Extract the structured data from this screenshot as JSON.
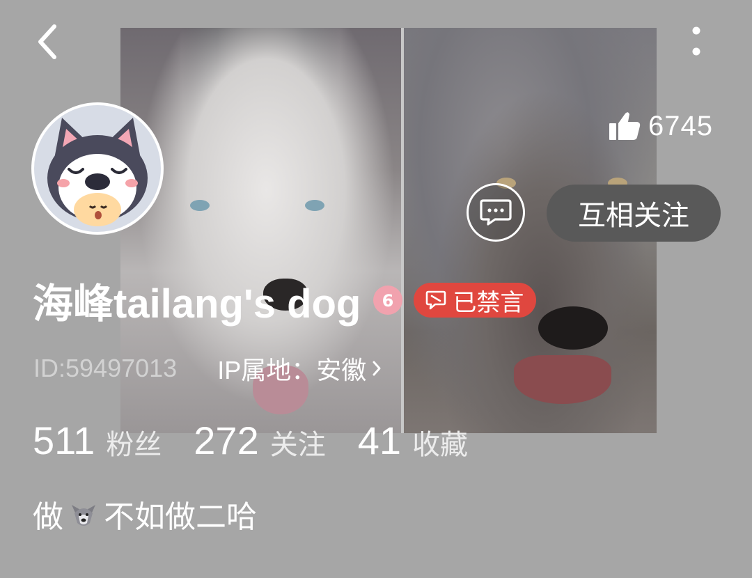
{
  "header": {
    "back_icon": "chevron-left-icon",
    "more_icon": "vertical-ellipsis-icon"
  },
  "profile": {
    "name": "海峰tailang's dog",
    "level_badge": "6",
    "muted_label": "已禁言",
    "user_id": "ID:59497013",
    "ip_label": "IP属地：安徽",
    "likes": "6745",
    "follow_label": "互相关注"
  },
  "stats": [
    {
      "num": "511",
      "label": "粉丝"
    },
    {
      "num": "272",
      "label": "关注"
    },
    {
      "num": "41",
      "label": "收藏"
    }
  ],
  "bio": {
    "before": "做",
    "after": "不如做二哈"
  },
  "colors": {
    "background": "#a6a6a6",
    "muted_badge": "#e0473f",
    "level_badge": "#f1a2ae",
    "follow_button": "#595959"
  }
}
